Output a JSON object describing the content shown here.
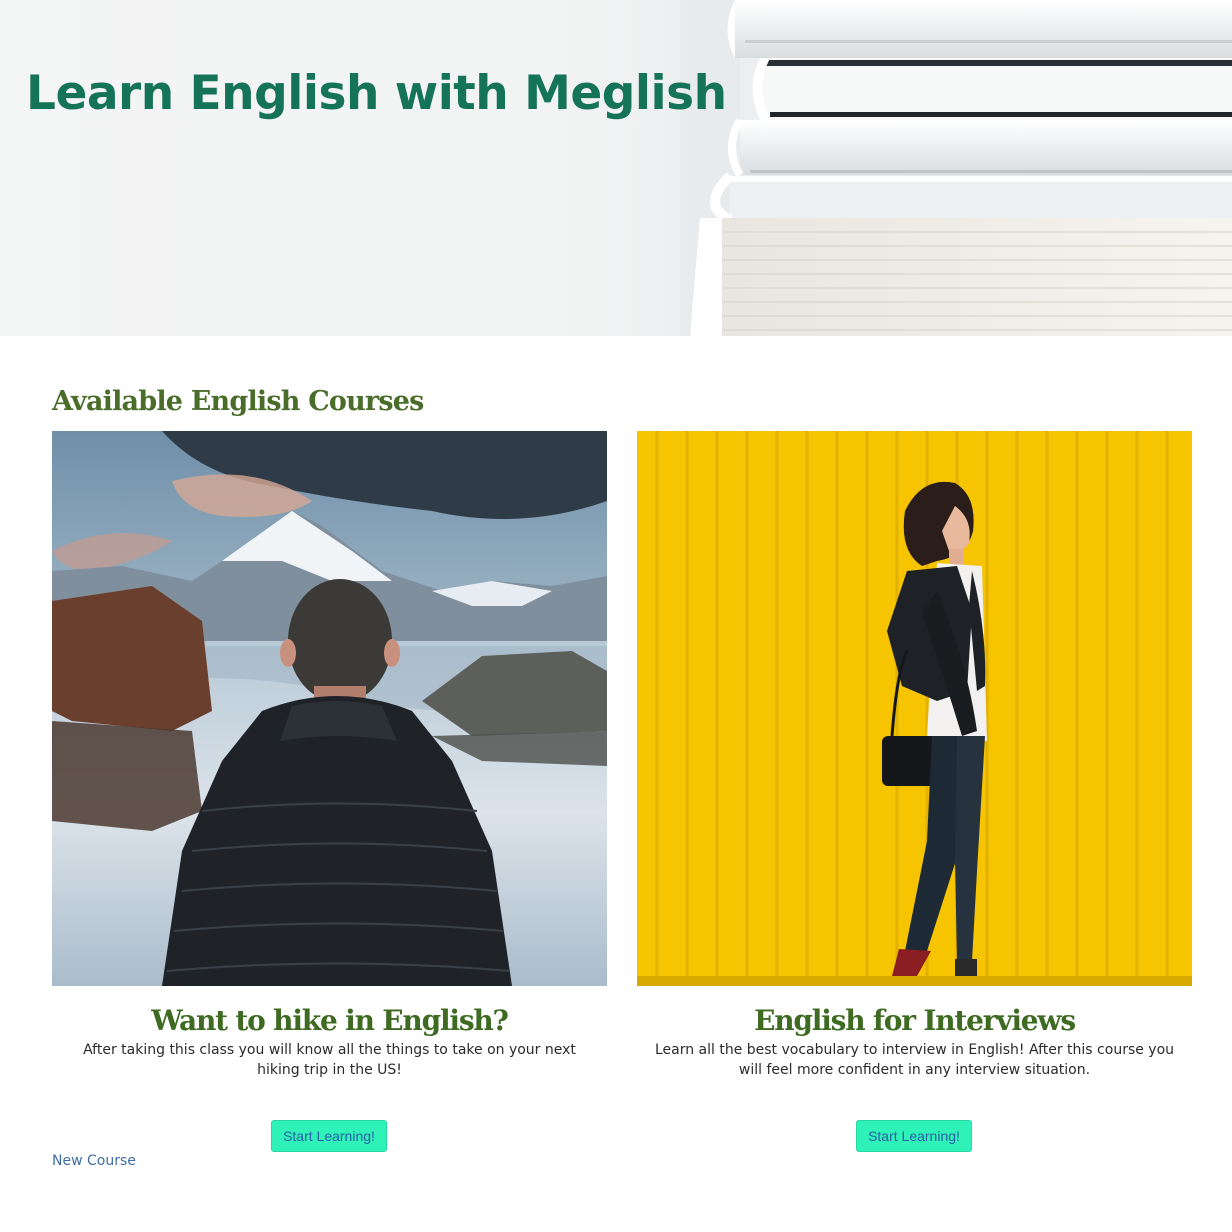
{
  "hero": {
    "title": "Learn English with Meglish",
    "image_icon": "book-stack-image"
  },
  "courses_section": {
    "title": "Available English Courses",
    "courses": [
      {
        "title": "Want to hike in English?",
        "description": "After taking this class you will know all the things to take on your next hiking trip in the US!",
        "button_label": "Start Learning!",
        "image_icon": "hiker-mountain-lake-image"
      },
      {
        "title": "English for Interviews",
        "description": "Learn all the best vocabulary to interview in English! After this course you will feel more confident in any interview situation.",
        "button_label": "Start Learning!",
        "image_icon": "woman-walking-yellow-wall-image"
      }
    ]
  },
  "footer": {
    "new_course_link": "New Course"
  },
  "colors": {
    "hero_title": "#157357",
    "section_title": "#4a6d2a",
    "card_title": "#3e6a22",
    "button_bg": "#2ef2b8",
    "button_text": "#2a5fa8",
    "link": "#3f6ea2"
  }
}
